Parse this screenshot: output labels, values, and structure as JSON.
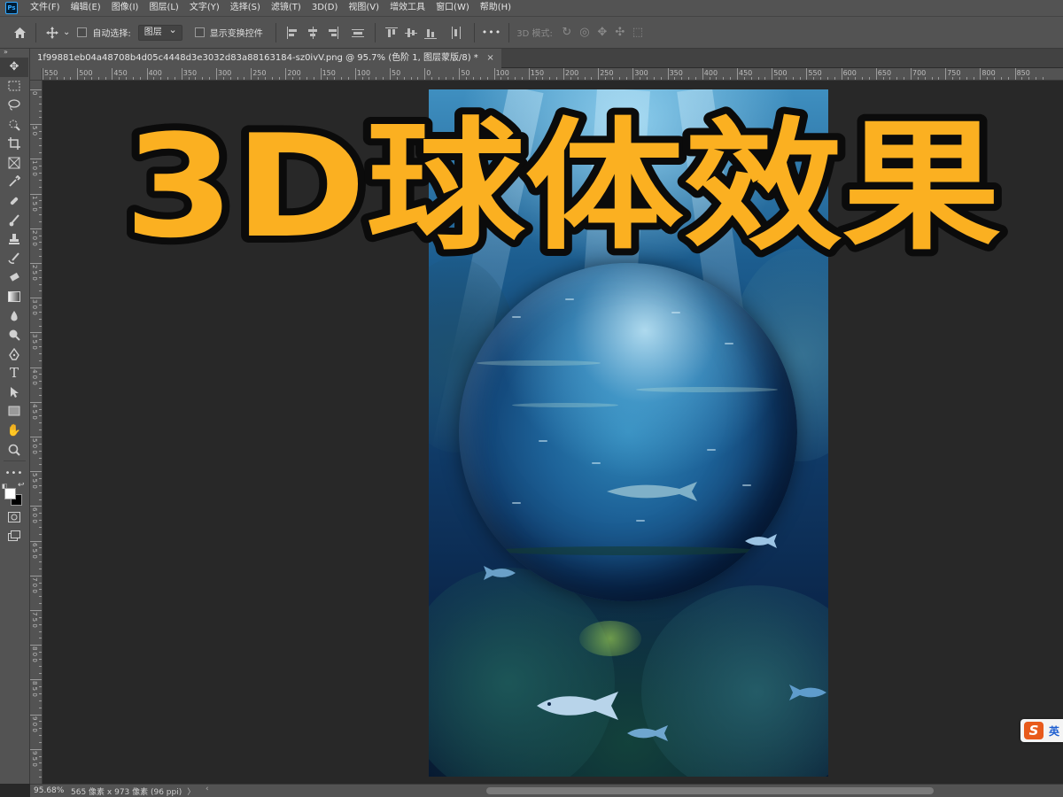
{
  "app": {
    "logo_text": "Ps"
  },
  "menu": [
    "文件(F)",
    "编辑(E)",
    "图像(I)",
    "图层(L)",
    "文字(Y)",
    "选择(S)",
    "滤镜(T)",
    "3D(D)",
    "视图(V)",
    "增效工具",
    "窗口(W)",
    "帮助(H)"
  ],
  "options": {
    "auto_select_label": "自动选择:",
    "auto_select_checked": false,
    "target_select": "图层",
    "show_transform_label": "显示变换控件",
    "show_transform_checked": false,
    "more": "•••",
    "mode_3d_label": "3D 模式:"
  },
  "document": {
    "tab_title": "1f99881eb04a48708b4d05c4448d3e3032d83a88163184-sz0ivV.png @ 95.7% (色阶 1, 图层蒙版/8) *",
    "close_glyph": "×"
  },
  "rulers": {
    "top_labels": [
      "550",
      "500",
      "450",
      "400",
      "350",
      "300",
      "250",
      "200",
      "150",
      "100",
      "50",
      "0",
      "50",
      "100",
      "150",
      "200",
      "250",
      "300",
      "350",
      "400",
      "450",
      "500",
      "550",
      "600",
      "650",
      "700",
      "750",
      "800",
      "850"
    ],
    "left_labels": [
      "0",
      "5 0",
      "1 0 0",
      "1 5 0",
      "2 0 0",
      "2 5 0",
      "3 0 0",
      "3 5 0",
      "4 0 0",
      "4 5 0",
      "5 0 0",
      "5 5 0",
      "6 0 0",
      "6 5 0",
      "7 0 0",
      "7 5 0",
      "8 0 0",
      "8 5 0",
      "9 0 0",
      "9 5 0"
    ]
  },
  "canvas": {
    "title_text": "3D球体效果",
    "title_fill": "#fbb021",
    "title_stroke": "#0b0b0b"
  },
  "toolbar": {
    "collapse_glyph": "»",
    "tools": [
      "move-tool",
      "marquee-tool",
      "lasso-tool",
      "quick-selection-tool",
      "crop-tool",
      "frame-tool",
      "eyedropper-tool",
      "healing-brush-tool",
      "brush-tool",
      "clone-stamp-tool",
      "history-brush-tool",
      "eraser-tool",
      "gradient-tool",
      "blur-tool",
      "dodge-tool",
      "pen-tool",
      "type-tool",
      "path-selection-tool",
      "rectangle-tool",
      "hand-tool",
      "zoom-tool",
      "edit-toolbar"
    ],
    "foreground_color": "#ffffff",
    "background_color": "#000000"
  },
  "status": {
    "zoom": "95.68%",
    "doc_info": "565 像素 x 973 像素 (96 ppi)",
    "arrow": "〉"
  },
  "ime": {
    "logo": "S",
    "lang": "英"
  }
}
